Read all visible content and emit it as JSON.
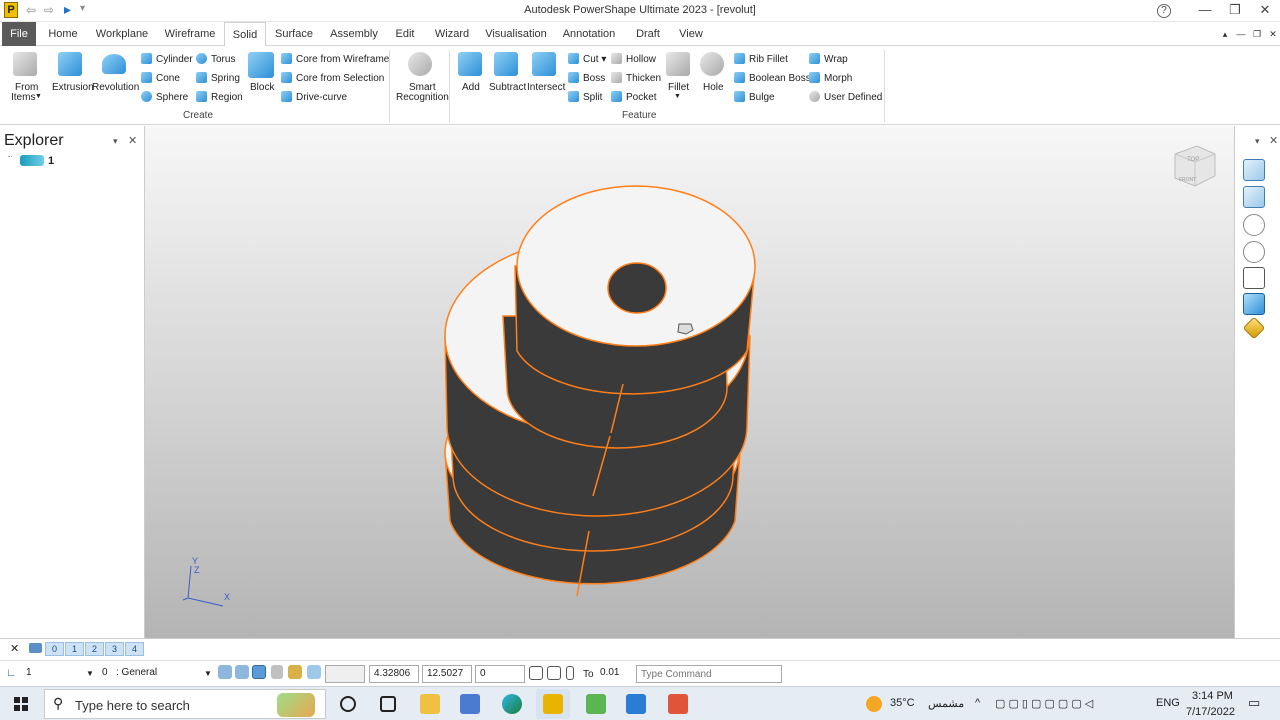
{
  "titlebar": {
    "title": "Autodesk PowerShape Ultimate 2023 - [revolut]",
    "app_icon": "P",
    "back_arrow": "⇦",
    "forward_arrow": "⇨",
    "select_arrow": "▸",
    "qat_more": "▾",
    "help": "?",
    "minimize": "—",
    "restore": "❐",
    "close": "✕"
  },
  "menu": {
    "tabs": [
      "File",
      "Home",
      "Workplane",
      "Wireframe",
      "Solid",
      "Surface",
      "Assembly",
      "Edit",
      "Wizard",
      "Visualisation",
      "Annotation",
      "Draft",
      "View"
    ],
    "active_tab": "Solid",
    "right": {
      "collapse": "▴",
      "min": "—",
      "restore": "❐",
      "close": "✕"
    }
  },
  "ribbon": {
    "create": {
      "label": "Create",
      "from_items": "From",
      "from_items_2": "Items",
      "extrusion": "Extrusion",
      "revolution": "Revolution",
      "cylinder": "Cylinder",
      "cone": "Cone",
      "sphere": "Sphere",
      "torus": "Torus",
      "spring": "Spring",
      "region": "Region",
      "block": "Block",
      "core_from_wireframe": "Core from Wireframe",
      "core_from_selection": "Core from Selection",
      "drive_curve": "Drive-curve"
    },
    "smart_recognition": "Smart",
    "smart_recognition_2": "Recognition",
    "feature": {
      "label": "Feature",
      "add": "Add",
      "subtract": "Subtract",
      "intersect": "Intersect",
      "cut": "Cut",
      "boss": "Boss",
      "split": "Split",
      "hollow": "Hollow",
      "thicken": "Thicken",
      "pocket": "Pocket",
      "fillet": "Fillet",
      "hole": "Hole",
      "rib_fillet": "Rib Fillet",
      "boolean_boss": "Boolean Boss",
      "bulge": "Bulge",
      "wrap": "Wrap",
      "morph": "Morph",
      "user_defined": "User Defined"
    }
  },
  "explorer": {
    "title": "Explorer",
    "item": "1",
    "pin": "▾",
    "close": "✕"
  },
  "rightpanel": {
    "pin": "▾",
    "close": "✕"
  },
  "viewcube": {
    "top": "TOP",
    "front": "FRONT"
  },
  "axes": {
    "y": "Y",
    "z": "Z",
    "x": "X"
  },
  "levels": {
    "close": "✕",
    "items": [
      "0",
      "1",
      "2",
      "3",
      "4"
    ]
  },
  "status": {
    "workplane": "1",
    "level": "0",
    "level_name": ": General",
    "x": "4.32806",
    "y": "12.5027",
    "z": "0",
    "to_label": "To",
    "tolerance": "0.01",
    "command_placeholder": "Type Command"
  },
  "taskbar": {
    "search_placeholder": "Type here to search",
    "temperature": "35°C",
    "weather": "مشمس",
    "language": "ENG",
    "time": "3:14 PM",
    "date": "7/17/2022"
  },
  "colors": {
    "accent": "#2e8fd6",
    "edge": "#ff7f1a",
    "face_dark": "#3a3a3a",
    "face_light": "#f4f4f4"
  }
}
